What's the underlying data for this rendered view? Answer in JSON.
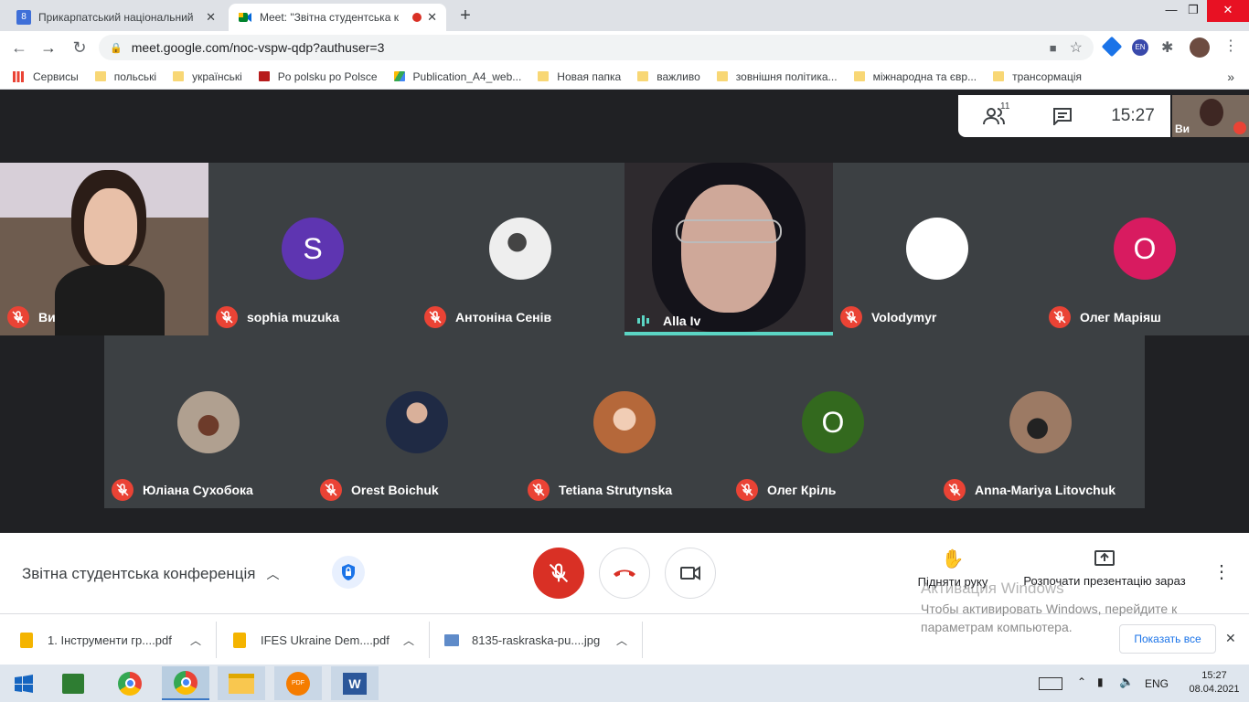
{
  "browser": {
    "tabs": [
      {
        "title": "Прикарпатський національний",
        "close": "✕"
      },
      {
        "title": "Meet: \"Звітна студентська к",
        "close": "✕"
      }
    ],
    "new_tab": "+",
    "window": {
      "min": "—",
      "max": "❐",
      "close": "✕"
    },
    "url": "meet.google.com/noc-vspw-qdp?authuser=3",
    "profile_badge": "EN",
    "bookmarks": [
      "Сервисы",
      "польські",
      "українські",
      "Po polsku po Polsce",
      "Publication_A4_web...",
      "Новая папка",
      "важливо",
      "зовнішня політика...",
      "міжнародна та євр...",
      "трансормація"
    ],
    "bookmarks_more": "»"
  },
  "meet": {
    "participants_count": "11",
    "time": "15:27",
    "self_label": "Ви",
    "tiles_row1": [
      {
        "name": "Ви",
        "initial": "",
        "color": ""
      },
      {
        "name": "sophia muzuka",
        "initial": "S",
        "color": "#5e35b1"
      },
      {
        "name": "Антоніна Сенів",
        "initial": "",
        "color": "#888888"
      },
      {
        "name": "Alla Iv",
        "initial": "",
        "color": ""
      },
      {
        "name": "Volodymyr",
        "initial": "",
        "color": "#ffffff"
      },
      {
        "name": "Олег Маріяш",
        "initial": "О",
        "color": "#d81b60"
      }
    ],
    "tiles_row2": [
      {
        "name": "Юліана Сухобока",
        "initial": "",
        "color": "#8d6e63"
      },
      {
        "name": "Orest Boichuk",
        "initial": "",
        "color": "#455a64"
      },
      {
        "name": "Tetiana Strutynska",
        "initial": "",
        "color": "#c58b5a"
      },
      {
        "name": "Олег Кріль",
        "initial": "О",
        "color": "#33691e"
      },
      {
        "name": "Anna-Mariya Litovchuk",
        "initial": "",
        "color": "#6d4c41"
      }
    ],
    "meeting_title": "Звітна студентська конференція",
    "raise_hand": "Підняти руку",
    "present": "Розпочати презентацію зараз",
    "more": "⋮"
  },
  "windows_activation": {
    "title": "Активация Windows",
    "line1": "Чтобы активировать Windows, перейдите к",
    "line2": "параметрам компьютера."
  },
  "downloads": {
    "items": [
      "1. Інструменти гр....pdf",
      "IFES Ukraine Dem....pdf",
      "8135-raskraska-pu....jpg"
    ],
    "show_all": "Показать все",
    "close": "✕"
  },
  "taskbar": {
    "lang": "ENG",
    "time": "15:27",
    "date": "08.04.2021"
  }
}
